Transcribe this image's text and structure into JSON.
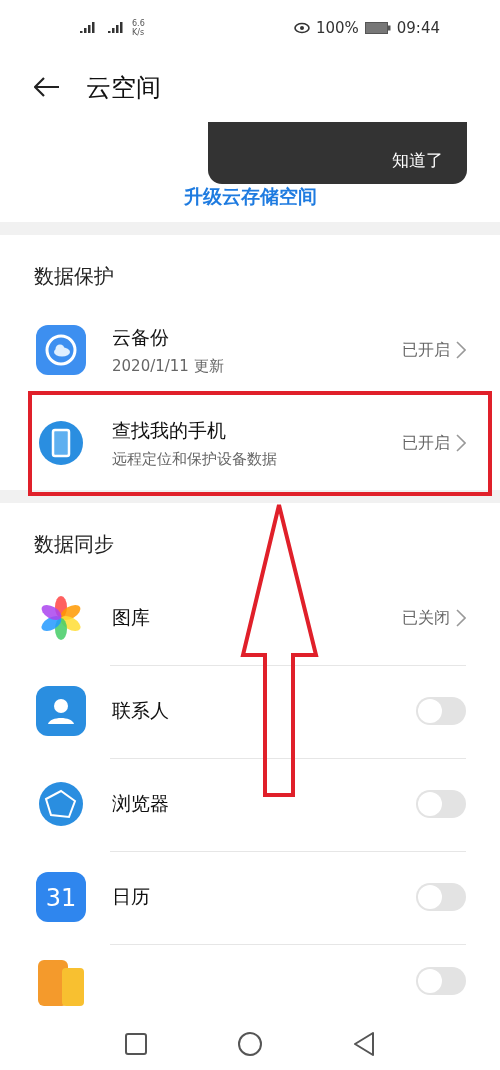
{
  "status_bar": {
    "net_speed": "6.6",
    "net_unit": "K/s",
    "battery": "100%",
    "time": "09:44"
  },
  "header": {
    "title": "云空间"
  },
  "popup": {
    "button": "知道了"
  },
  "upgrade_link": "升级云存储空间",
  "sections": [
    {
      "title": "数据保护",
      "items": [
        {
          "kind": "status",
          "title": "云备份",
          "subtitle": "2020/1/11 更新",
          "status": "已开启"
        },
        {
          "kind": "status",
          "title": "查找我的手机",
          "subtitle": "远程定位和保护设备数据",
          "status": "已开启",
          "highlighted": true
        }
      ]
    },
    {
      "title": "数据同步",
      "items": [
        {
          "kind": "status",
          "title": "图库",
          "status": "已关闭"
        },
        {
          "kind": "switch",
          "title": "联系人",
          "on": false
        },
        {
          "kind": "switch",
          "title": "浏览器",
          "on": false
        },
        {
          "kind": "switch",
          "title": "日历",
          "icon_text": "31",
          "on": false
        },
        {
          "kind": "cut",
          "on": false
        }
      ]
    }
  ]
}
